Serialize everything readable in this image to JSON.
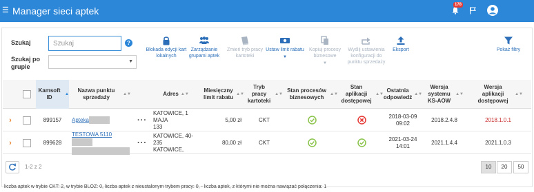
{
  "header": {
    "title": "Manager sieci aptek",
    "notification_count": "178",
    "menu_icon": "hamburger-icon",
    "bell_icon": "bell-icon",
    "flag_icon": "flag-icon",
    "user_icon": "user-avatar-icon"
  },
  "filters": {
    "search_label": "Szukaj",
    "search_placeholder": "Szukaj",
    "group_label_line1": "Szukaj po",
    "group_label_line2": "grupie",
    "group_value": ""
  },
  "toolbar": {
    "lock": {
      "line1": "Blokada edycji kart",
      "line2": "lokalnych",
      "icon": "lock-icon"
    },
    "groups": {
      "line1": "Zarządzanie",
      "line2": "grupami aptek",
      "icon": "users-group-icon"
    },
    "mode": {
      "line1": "Zmień tryb pracy",
      "line2": "kartoteki",
      "icon": "book-icon"
    },
    "discount": {
      "line1": "Ustaw limit rabatu",
      "line2": "",
      "icon": "money-icon"
    },
    "copy": {
      "line1": "Kopiuj procesy",
      "line2": "biznesowe",
      "icon": "copy-icon"
    },
    "send": {
      "line1": "Wyślij ustawienia",
      "line2": "konfiguracji do",
      "line3": "punktu sprzedaży",
      "icon": "share-icon"
    },
    "export": {
      "line1": "Eksport",
      "icon": "upload-icon"
    },
    "filters": {
      "line1": "Pokaż filtry",
      "icon": "filter-icon"
    }
  },
  "table": {
    "columns": {
      "kamsoft_id": "Kamsoft ID",
      "name": "Nazwa punktu sprzedaży",
      "address": "Adres",
      "limit": "Miesięczny limit rabatu",
      "mode": "Tryb pracy kartoteki",
      "processes": "Stan procesów biznesowych",
      "app_state": "Stan aplikacji dostępowej",
      "last_reply": "Ostatnia odpowiedź",
      "system_version": "Wersja systemu KS-AOW",
      "app_version": "Wersja aplikacji dostępowej"
    },
    "rows": [
      {
        "id": "899157",
        "name": "Apteka",
        "address_line1": "KATOWICE, 1 MAJA",
        "address_line2": "133",
        "limit": "5,00 zł",
        "mode": "CKT",
        "processes_state": "ok",
        "app_state": "error",
        "last_reply_date": "2018-03-09",
        "last_reply_time": "09:02",
        "system_version": "2018.2.4.8",
        "app_version": "2018.1.0.1"
      },
      {
        "id": "899628",
        "name": "TESTOWA 5110",
        "address_line1": "KATOWICE, 40-235",
        "address_line2": "KATOWICE,",
        "limit": "80,00 zł",
        "mode": "CKT",
        "processes_state": "ok",
        "app_state": "ok",
        "last_reply_date": "2021-03-24",
        "last_reply_time": "14:01",
        "system_version": "2021.1.4.4",
        "app_version": "2021.1.0.3"
      }
    ]
  },
  "pagination": {
    "info": "1-2 z 2",
    "sizes": [
      "10",
      "20",
      "50"
    ],
    "selected": "10"
  },
  "footer": "liczba aptek w trybie CKT: 2, w trybie BLOZ: 0, liczba aptek z nieustalonym trybem pracy: 0, - liczba aptek, z którymi nie można nawiązać połączenia: 1",
  "colors": {
    "primary": "#2c87d9",
    "ok": "#8bc34a",
    "error": "#e53935",
    "warning_text": "#c62828",
    "expand": "#e8822d"
  }
}
